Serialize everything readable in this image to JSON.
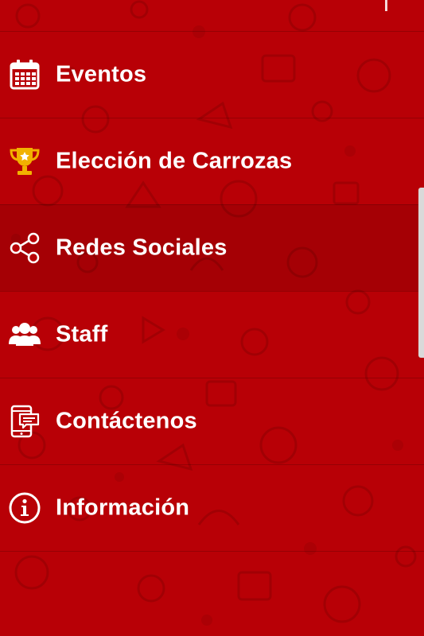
{
  "theme": {
    "background": "#b80006",
    "text": "#ffffff",
    "trophy_gold": "#f2b200"
  },
  "menu": {
    "items": [
      {
        "label": "Eventos",
        "icon": "calendar-icon"
      },
      {
        "label": "Elección de Carrozas",
        "icon": "trophy-icon"
      },
      {
        "label": "Redes Sociales",
        "icon": "share-icon"
      },
      {
        "label": "Staff",
        "icon": "group-icon"
      },
      {
        "label": "Contáctenos",
        "icon": "mobile-message-icon"
      },
      {
        "label": "Información",
        "icon": "info-icon"
      }
    ]
  }
}
